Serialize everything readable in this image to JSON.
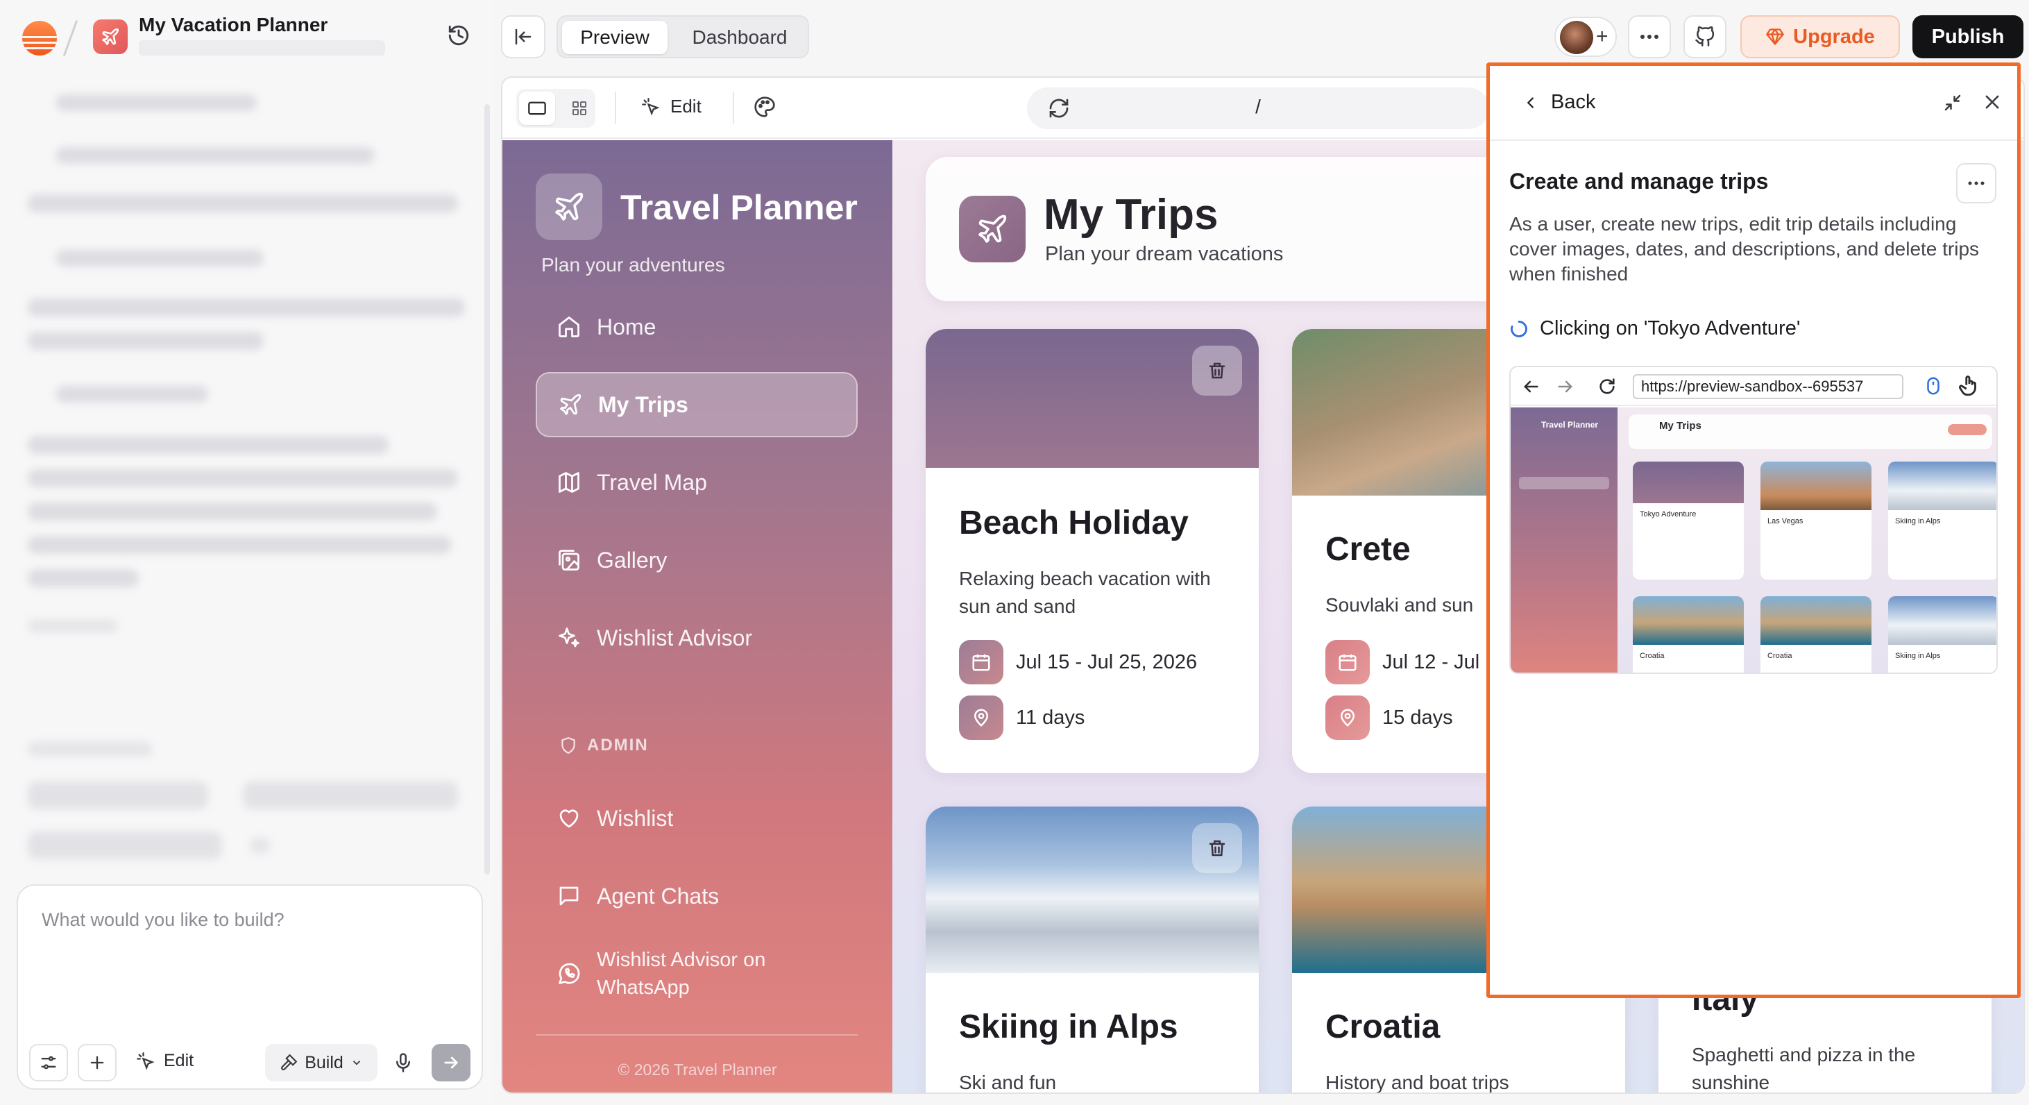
{
  "project": {
    "title": "My Vacation Planner"
  },
  "composer": {
    "placeholder": "What would you like to build?",
    "edit_label": "Edit",
    "build_label": "Build"
  },
  "toolbar": {
    "preview_label": "Preview",
    "dashboard_label": "Dashboard",
    "upgrade_label": "Upgrade",
    "publish_label": "Publish",
    "active_view": "Preview"
  },
  "preview": {
    "edit_label": "Edit",
    "url_path": "/"
  },
  "app": {
    "brand": "Travel Planner",
    "tagline": "Plan your adventures",
    "nav": [
      {
        "label": "Home",
        "icon": "home-icon",
        "active": false
      },
      {
        "label": "My Trips",
        "icon": "plane-icon",
        "active": true
      },
      {
        "label": "Travel Map",
        "icon": "map-icon",
        "active": false
      },
      {
        "label": "Gallery",
        "icon": "gallery-icon",
        "active": false
      },
      {
        "label": "Wishlist Advisor",
        "icon": "sparkles-icon",
        "active": false
      }
    ],
    "admin_label": "ADMIN",
    "admin_nav": [
      {
        "label": "Wishlist",
        "icon": "heart-icon"
      },
      {
        "label": "Agent Chats",
        "icon": "chat-icon"
      },
      {
        "label": "Wishlist Advisor on WhatsApp",
        "icon": "whatsapp-icon"
      }
    ],
    "footer": "© 2026 Travel Planner",
    "page_title": "My Trips",
    "page_subtitle": "Plan your dream vacations",
    "trips": [
      {
        "title": "Beach Holiday",
        "description": "Relaxing beach vacation with sun and sand",
        "dates": "Jul 15 - Jul 25, 2026",
        "duration": "11 days"
      },
      {
        "title": "Crete",
        "description": "Souvlaki and sun",
        "dates": "Jul 12 - Jul",
        "duration": "15 days"
      },
      {
        "title": "Skiing in Alps",
        "description": "Ski and fun"
      },
      {
        "title": "Croatia",
        "description": "History and boat trips"
      },
      {
        "title": "Italy",
        "description": "Spaghetti and pizza in the sunshine"
      }
    ]
  },
  "agent_panel": {
    "back_label": "Back",
    "title": "Create and manage trips",
    "description": "As a user, create new trips, edit trip details including cover images, dates, and descriptions, and delete trips when finished",
    "status": "Clicking on 'Tokyo Adventure'",
    "browser_url": "https://preview-sandbox--695537",
    "mini": {
      "brand": "Travel Planner",
      "page_title": "My Trips",
      "cards": [
        {
          "title": "Tokyo Adventure"
        },
        {
          "title": "Las Vegas"
        },
        {
          "title": "Skiing in Alps"
        },
        {
          "title": "Croatia"
        },
        {
          "title": "Croatia"
        },
        {
          "title": "Skiing in Alps"
        }
      ]
    }
  },
  "colors": {
    "accent_orange": "#f06b2a",
    "publish_bg": "#131316",
    "sidebar_top": "#7c6a94",
    "sidebar_bottom": "#e38680"
  }
}
